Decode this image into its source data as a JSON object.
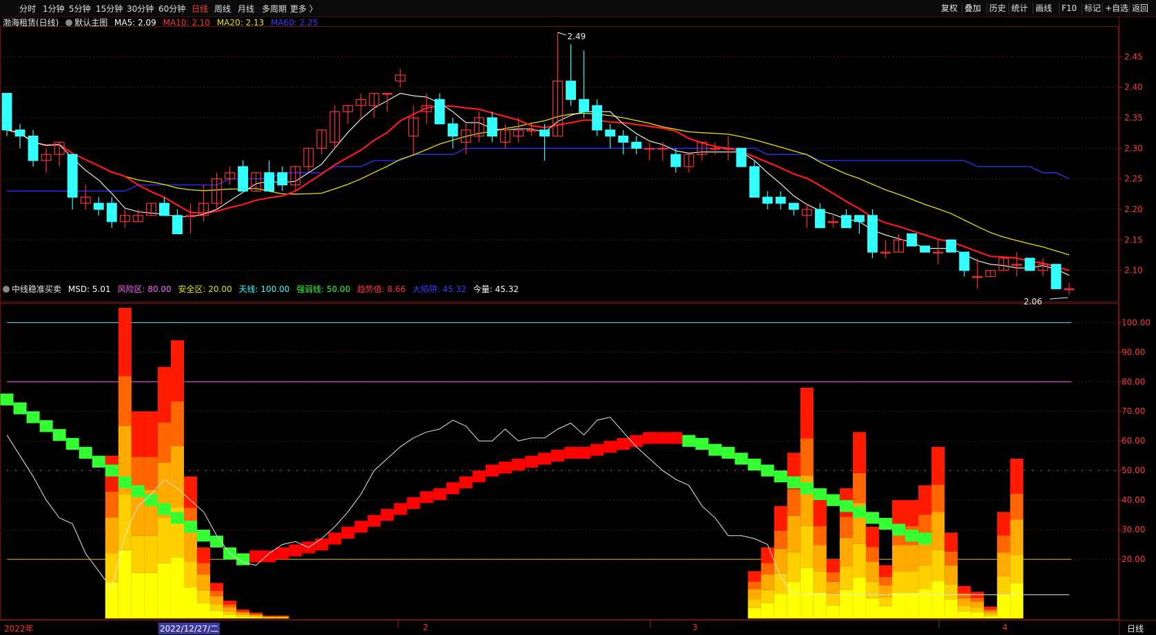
{
  "toolbar": {
    "periods": [
      "分时",
      "1分钟",
      "5分钟",
      "15分钟",
      "30分钟",
      "60分钟",
      "日线",
      "周线",
      "月线",
      "多周期",
      "更多 〉"
    ],
    "active_period": "日线",
    "actions": [
      "复权",
      "叠加",
      "历史",
      "统计",
      "画线",
      "F10",
      "标记",
      "+自选",
      "返回"
    ]
  },
  "main_legend": {
    "stock": "渤海租赁(日线)",
    "template": "默认主图",
    "ma5": "MA5: 2.09",
    "ma10": "MA10: 2.10",
    "ma20": "MA20: 2.13",
    "ma60": "MA60: 2.25"
  },
  "sub_legend": {
    "name": "中线稳准买卖",
    "msd": "MSD: 5.01",
    "risk": "风险区: 80.00",
    "safe": "安全区: 20.00",
    "sky": "天线: 100.00",
    "strong": "强弱线: 50.00",
    "trend": "趋势值: 8.66",
    "bigpit": "大陷阱: 45.32",
    "today": "今量: 45.32"
  },
  "bottom_axis": {
    "labels": [
      "2022年",
      "2022/12/27/二",
      "2",
      "3",
      "4"
    ],
    "period_label": "日线"
  },
  "colors": {
    "up": "#ff3333",
    "down": "#33ffff",
    "ma5": "#ffffff",
    "ma10": "#ff1a1a",
    "ma20": "#e6e600",
    "ma60": "#3333ff",
    "msd_up": "#ff0000",
    "msd_down": "#33ff33"
  },
  "chart_data": [
    {
      "type": "candlestick",
      "title": "渤海租赁(日线)",
      "ylim": [
        2.05,
        2.5
      ],
      "yticks": [
        2.1,
        2.15,
        2.2,
        2.25,
        2.3,
        2.35,
        2.4,
        2.45
      ],
      "annotations": [
        {
          "text": "2.49",
          "label": "high"
        },
        {
          "text": "2.06",
          "label": "low"
        }
      ],
      "candles": [
        [
          2.39,
          2.39,
          2.32,
          2.33
        ],
        [
          2.33,
          2.34,
          2.3,
          2.32
        ],
        [
          2.32,
          2.33,
          2.27,
          2.28
        ],
        [
          2.28,
          2.3,
          2.26,
          2.29
        ],
        [
          2.29,
          2.31,
          2.27,
          2.31
        ],
        [
          2.29,
          2.29,
          2.2,
          2.22
        ],
        [
          2.21,
          2.24,
          2.2,
          2.22
        ],
        [
          2.21,
          2.22,
          2.19,
          2.2
        ],
        [
          2.21,
          2.22,
          2.17,
          2.18
        ],
        [
          2.18,
          2.2,
          2.17,
          2.19
        ],
        [
          2.18,
          2.2,
          2.18,
          2.19
        ],
        [
          2.19,
          2.21,
          2.19,
          2.21
        ],
        [
          2.21,
          2.22,
          2.19,
          2.19
        ],
        [
          2.19,
          2.2,
          2.16,
          2.16
        ],
        [
          2.19,
          2.21,
          2.16,
          2.19
        ],
        [
          2.19,
          2.24,
          2.18,
          2.21
        ],
        [
          2.21,
          2.26,
          2.2,
          2.25
        ],
        [
          2.25,
          2.27,
          2.24,
          2.26
        ],
        [
          2.27,
          2.28,
          2.25,
          2.23
        ],
        [
          2.23,
          2.26,
          2.23,
          2.26
        ],
        [
          2.26,
          2.28,
          2.24,
          2.23
        ],
        [
          2.26,
          2.27,
          2.23,
          2.24
        ],
        [
          2.24,
          2.27,
          2.23,
          2.27
        ],
        [
          2.27,
          2.3,
          2.26,
          2.3
        ],
        [
          2.3,
          2.33,
          2.29,
          2.33
        ],
        [
          2.31,
          2.37,
          2.3,
          2.36
        ],
        [
          2.36,
          2.37,
          2.34,
          2.37
        ],
        [
          2.37,
          2.39,
          2.35,
          2.38
        ],
        [
          2.37,
          2.39,
          2.35,
          2.39
        ],
        [
          2.39,
          2.39,
          2.36,
          2.39
        ],
        [
          2.41,
          2.43,
          2.4,
          2.42
        ],
        [
          2.32,
          2.37,
          2.29,
          2.35
        ],
        [
          2.36,
          2.39,
          2.34,
          2.37
        ],
        [
          2.38,
          2.39,
          2.34,
          2.34
        ],
        [
          2.34,
          2.35,
          2.3,
          2.32
        ],
        [
          2.31,
          2.34,
          2.29,
          2.33
        ],
        [
          2.32,
          2.36,
          2.31,
          2.35
        ],
        [
          2.35,
          2.36,
          2.31,
          2.32
        ],
        [
          2.31,
          2.34,
          2.3,
          2.33
        ],
        [
          2.32,
          2.35,
          2.31,
          2.33
        ],
        [
          2.33,
          2.34,
          2.32,
          2.33
        ],
        [
          2.33,
          2.34,
          2.28,
          2.32
        ],
        [
          2.32,
          2.49,
          2.32,
          2.41
        ],
        [
          2.41,
          2.47,
          2.37,
          2.38
        ],
        [
          2.38,
          2.46,
          2.35,
          2.36
        ],
        [
          2.37,
          2.38,
          2.32,
          2.33
        ],
        [
          2.33,
          2.34,
          2.3,
          2.32
        ],
        [
          2.32,
          2.33,
          2.29,
          2.31
        ],
        [
          2.31,
          2.32,
          2.29,
          2.3
        ],
        [
          2.3,
          2.31,
          2.28,
          2.3
        ],
        [
          2.3,
          2.31,
          2.28,
          2.3
        ],
        [
          2.29,
          2.3,
          2.26,
          2.27
        ],
        [
          2.27,
          2.29,
          2.26,
          2.29
        ],
        [
          2.29,
          2.31,
          2.28,
          2.31
        ],
        [
          2.3,
          2.31,
          2.29,
          2.3
        ],
        [
          2.3,
          2.32,
          2.28,
          2.3
        ],
        [
          2.3,
          2.3,
          2.27,
          2.27
        ],
        [
          2.27,
          2.28,
          2.22,
          2.22
        ],
        [
          2.22,
          2.23,
          2.2,
          2.21
        ],
        [
          2.22,
          2.23,
          2.2,
          2.21
        ],
        [
          2.21,
          2.21,
          2.19,
          2.2
        ],
        [
          2.19,
          2.21,
          2.17,
          2.2
        ],
        [
          2.2,
          2.21,
          2.17,
          2.17
        ],
        [
          2.18,
          2.19,
          2.17,
          2.18
        ],
        [
          2.19,
          2.2,
          2.17,
          2.17
        ],
        [
          2.19,
          2.19,
          2.16,
          2.18
        ],
        [
          2.19,
          2.2,
          2.12,
          2.13
        ],
        [
          2.13,
          2.15,
          2.12,
          2.13
        ],
        [
          2.13,
          2.16,
          2.13,
          2.15
        ],
        [
          2.16,
          2.16,
          2.14,
          2.14
        ],
        [
          2.14,
          2.14,
          2.13,
          2.13
        ],
        [
          2.13,
          2.15,
          2.11,
          2.13
        ],
        [
          2.15,
          2.15,
          2.13,
          2.13
        ],
        [
          2.13,
          2.13,
          2.09,
          2.1
        ],
        [
          2.09,
          2.12,
          2.07,
          2.09
        ],
        [
          2.09,
          2.1,
          2.09,
          2.1
        ],
        [
          2.1,
          2.12,
          2.1,
          2.12
        ],
        [
          2.11,
          2.13,
          2.09,
          2.11
        ],
        [
          2.12,
          2.12,
          2.1,
          2.1
        ],
        [
          2.1,
          2.12,
          2.09,
          2.11
        ],
        [
          2.11,
          2.11,
          2.07,
          2.07
        ],
        [
          2.07,
          2.08,
          2.06,
          2.07
        ]
      ],
      "ma60": [
        2.23,
        2.23,
        2.23,
        2.23,
        2.23,
        2.23,
        2.23,
        2.23,
        2.23,
        2.23,
        2.24,
        2.24,
        2.24,
        2.24,
        2.24,
        2.24,
        2.24,
        2.25,
        2.25,
        2.25,
        2.25,
        2.26,
        2.26,
        2.26,
        2.26,
        2.27,
        2.27,
        2.27,
        2.28,
        2.28,
        2.28,
        2.29,
        2.29,
        2.29,
        2.29,
        2.3,
        2.3,
        2.3,
        2.3,
        2.3,
        2.3,
        2.3,
        2.3,
        2.3,
        2.3,
        2.3,
        2.3,
        2.3,
        2.3,
        2.3,
        2.3,
        2.3,
        2.3,
        2.3,
        2.3,
        2.3,
        2.3,
        2.3,
        2.29,
        2.29,
        2.29,
        2.29,
        2.28,
        2.28,
        2.28,
        2.28,
        2.28,
        2.28,
        2.28,
        2.28,
        2.28,
        2.28,
        2.28,
        2.28,
        2.27,
        2.27,
        2.27,
        2.27,
        2.27,
        2.26,
        2.26,
        2.25
      ]
    },
    {
      "type": "bar",
      "title": "中线稳准买卖",
      "ylim": [
        0,
        105
      ],
      "yticks": [
        20,
        30,
        40,
        50,
        60,
        70,
        80,
        90,
        100
      ],
      "hlines": [
        {
          "value": 100,
          "name": "天线"
        },
        {
          "value": 80,
          "name": "风险区"
        },
        {
          "value": 50,
          "name": "强弱线"
        },
        {
          "value": 20,
          "name": "安全区"
        }
      ],
      "volume": [
        0,
        0,
        0,
        0,
        0,
        0,
        0,
        0,
        55,
        105,
        70,
        70,
        85,
        94,
        48,
        24,
        12,
        6,
        3,
        2,
        1,
        1,
        0,
        0,
        0,
        0,
        0,
        0,
        0,
        0,
        0,
        0,
        0,
        0,
        0,
        0,
        0,
        0,
        0,
        0,
        0,
        0,
        0,
        0,
        0,
        0,
        0,
        0,
        0,
        0,
        0,
        0,
        0,
        0,
        0,
        0,
        0,
        16,
        24,
        38,
        56,
        78,
        40,
        20,
        44,
        63,
        31,
        18,
        40,
        40,
        45,
        58,
        29,
        11,
        9,
        4,
        36,
        54,
        0,
        0,
        0,
        0
      ],
      "trend_line": [
        62,
        55,
        48,
        40,
        34,
        32,
        22,
        16,
        10,
        28,
        38,
        42,
        47,
        44,
        40,
        36,
        28,
        22,
        19,
        18,
        22,
        25,
        26,
        24,
        27,
        31,
        36,
        42,
        50,
        54,
        58,
        61,
        63,
        64,
        67,
        65,
        60,
        60,
        64,
        60,
        61,
        61,
        64,
        66,
        62,
        67,
        68,
        63,
        58,
        54,
        50,
        47,
        45,
        38,
        34,
        28,
        28,
        27,
        25,
        14,
        8,
        8,
        8,
        8,
        8,
        8,
        8,
        8,
        8,
        8,
        8,
        8,
        8,
        8,
        8,
        8,
        8,
        8,
        8,
        8,
        8,
        8
      ],
      "msd": [
        74,
        71,
        68,
        65,
        62,
        59,
        56,
        53,
        50,
        46,
        43,
        40,
        37,
        34,
        31,
        28,
        26,
        22,
        20,
        21,
        21,
        22,
        23,
        24,
        25,
        27,
        29,
        31,
        33,
        35,
        37,
        39,
        41,
        42,
        44,
        46,
        48,
        50,
        51,
        52,
        53,
        54,
        55,
        56,
        56,
        57,
        58,
        59,
        60,
        61,
        61,
        61,
        60,
        59,
        57,
        56,
        54,
        52,
        50,
        48,
        46,
        44,
        42,
        40,
        38,
        36,
        34,
        32,
        30,
        28,
        27
      ]
    }
  ]
}
